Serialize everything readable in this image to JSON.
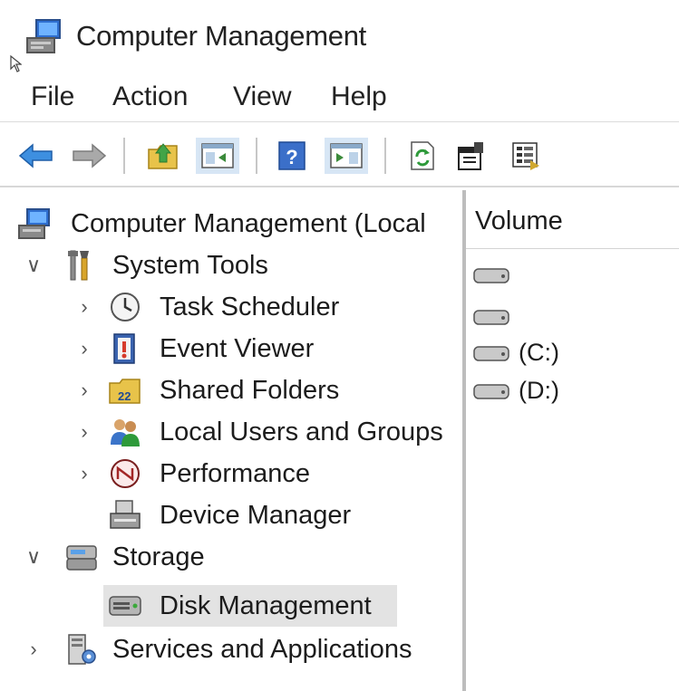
{
  "window": {
    "title": "Computer Management",
    "icon": "computer-management-icon"
  },
  "menu": {
    "items": [
      "File",
      "Action",
      "View",
      "Help"
    ]
  },
  "toolbar": {
    "buttons": [
      "back-arrow-icon",
      "forward-arrow-icon",
      "up-folder-icon",
      "show-hide-console-tree-icon",
      "help-icon",
      "show-hide-action-pane-icon",
      "refresh-icon",
      "properties-icon",
      "export-list-icon"
    ]
  },
  "tree": {
    "root": "Computer Management (Local",
    "system_tools": "System Tools",
    "task_scheduler": "Task Scheduler",
    "event_viewer": "Event Viewer",
    "shared_folders": "Shared Folders",
    "local_users": "Local Users and Groups",
    "performance": "Performance",
    "device_manager": "Device Manager",
    "storage": "Storage",
    "disk_management": "Disk Management",
    "services": "Services and Applications",
    "selected": "Disk Management"
  },
  "volumes": {
    "column_header": "Volume",
    "rows": [
      "",
      "",
      "(C:)",
      "(D:)"
    ]
  },
  "colors": {
    "selection": "#e3e3e3",
    "accent_blue": "#2f7fd6"
  }
}
